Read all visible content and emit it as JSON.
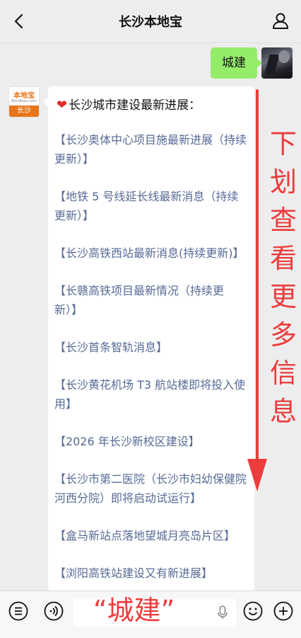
{
  "header": {
    "title": "长沙本地宝"
  },
  "user_message": {
    "text": "城建"
  },
  "bot": {
    "avatar_top": "本地宝",
    "avatar_domain": "Bendibao.com",
    "avatar_city": "长沙",
    "heading": "长沙城市建设最新进展：",
    "links": [
      "【长沙奥体中心项目施最新进展（持续更新）】",
      "【地铁 5 号线延长线最新消息（持续更新）】",
      "【长沙高铁西站最新消息(持续更新)】",
      "【长赣高铁项目最新情况（持续更新）】",
      "【长沙首条智轨消息】",
      "【长沙黄花机场 T3 航站楼即将投入使用】",
      "【2026 年长沙新校区建设】",
      "【长沙市第二医院（长沙市妇幼保健院河西分院）即将启动试运行】",
      "【盒马新站点落地望城月亮岛片区】",
      "【浏阳高铁站建设又有新进展】"
    ]
  },
  "overlay": {
    "side_chars": [
      "下",
      "划",
      "查",
      "看",
      "更",
      "多",
      "信",
      "息"
    ],
    "bottom_text": "“城建”",
    "accent_color": "#ec3c3c"
  },
  "bottom_bar": {
    "icons": [
      "menu-list-icon",
      "voice-icon",
      "microphone-icon",
      "emoji-icon",
      "plus-icon"
    ]
  }
}
